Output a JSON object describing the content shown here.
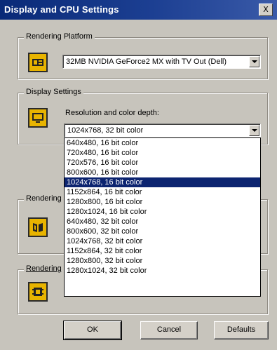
{
  "window": {
    "title": "Display and CPU Settings",
    "close_glyph": "X"
  },
  "rendering_platform": {
    "label": "Rendering Platform",
    "icon": "display-adapter-icon",
    "value": "32MB NVIDIA GeForce2 MX with TV Out (Dell)"
  },
  "display_settings": {
    "label": "Display Settings",
    "icon": "monitor-icon",
    "resolution_label": "Resolution and color depth:",
    "value": "1024x768, 32 bit color",
    "options": [
      "640x480, 16 bit color",
      "720x480, 16 bit color",
      "720x576, 16 bit color",
      "800x600, 16 bit color",
      "1024x768, 16 bit color",
      "1152x864, 16 bit color",
      "1280x800, 16 bit color",
      "1280x1024, 16 bit color",
      "640x480, 32 bit color",
      "800x600, 32 bit color",
      "1024x768, 32 bit color",
      "1152x864, 32 bit color",
      "1280x800, 32 bit color",
      "1280x1024, 32 bit color"
    ],
    "highlighted_option": "1024x768, 16 bit color"
  },
  "rendering_group_1": {
    "label": "Rendering",
    "icon": "book-icon"
  },
  "rendering_group_2": {
    "label": "Rendering",
    "icon": "cpu-chip-icon"
  },
  "buttons": {
    "ok": "OK",
    "cancel": "Cancel",
    "defaults": "Defaults"
  },
  "colors": {
    "title_bar": "#0a2a78",
    "highlight": "#0c2470",
    "icon_background": "#e8b400",
    "dialog_background": "#c7c4bc"
  }
}
